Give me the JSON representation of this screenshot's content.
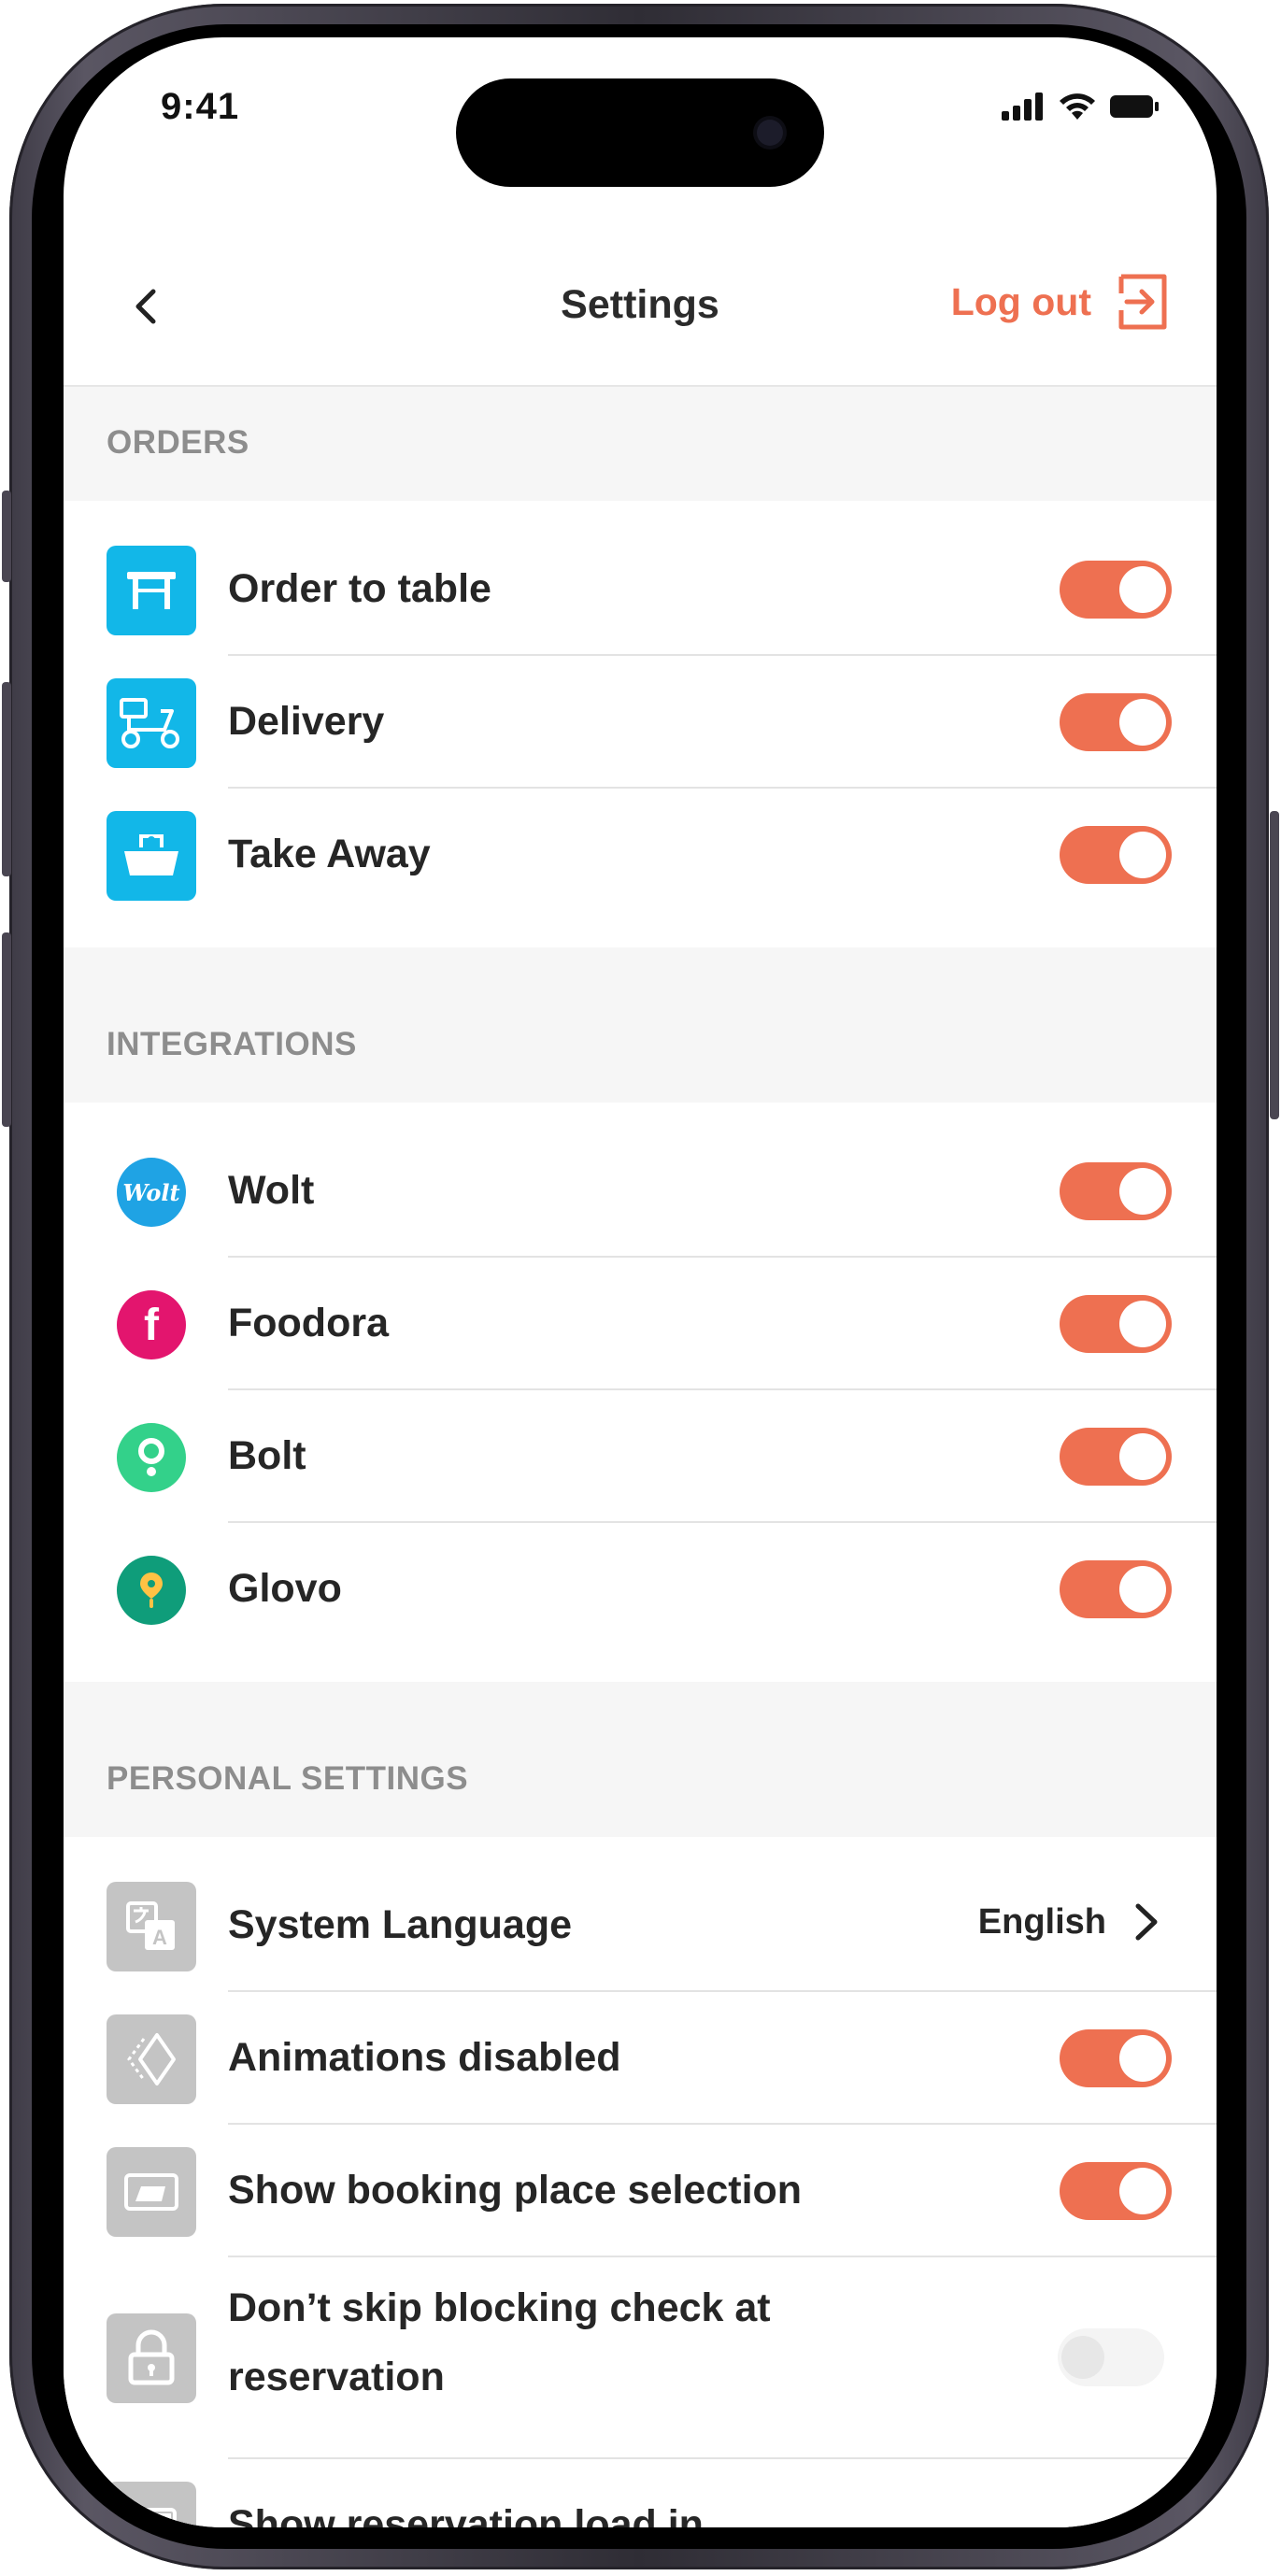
{
  "status": {
    "time": "9:41"
  },
  "header": {
    "title": "Settings",
    "logout_label": "Log out"
  },
  "sections": {
    "orders": {
      "title": "ORDERS",
      "items": [
        {
          "label": "Order to table",
          "icon": "table-icon",
          "on": true
        },
        {
          "label": "Delivery",
          "icon": "scooter-icon",
          "on": true
        },
        {
          "label": "Take Away",
          "icon": "takeaway-bag-icon",
          "on": true
        }
      ]
    },
    "integrations": {
      "title": "INTEGRATIONS",
      "items": [
        {
          "label": "Wolt",
          "logo_text": "Wolt",
          "color": "#1fa3e4",
          "on": true
        },
        {
          "label": "Foodora",
          "logo_text": "f",
          "color": "#e3156e",
          "on": true
        },
        {
          "label": "Bolt",
          "color": "#33d18a",
          "on": true
        },
        {
          "label": "Glovo",
          "color": "#0f9d7a",
          "on": true
        }
      ]
    },
    "personal": {
      "title": "PERSONAL SETTINGS",
      "items": [
        {
          "label": "System Language",
          "icon": "language-icon",
          "value": "English"
        },
        {
          "label": "Animations disabled",
          "icon": "animation-icon",
          "on": true
        },
        {
          "label": "Show booking place selection",
          "icon": "booking-place-icon",
          "on": true
        },
        {
          "label_line1": "Don’t skip blocking check at",
          "label_line2": "reservation",
          "icon": "lock-icon",
          "on": false
        },
        {
          "label": "Show reservation load in",
          "icon": "reservation-load-icon"
        }
      ]
    }
  },
  "colors": {
    "accent": "#ee7051",
    "order_icon_bg": "#12b7e8",
    "personal_icon_bg": "#c4c4c4",
    "section_bg": "#f6f6f6"
  }
}
